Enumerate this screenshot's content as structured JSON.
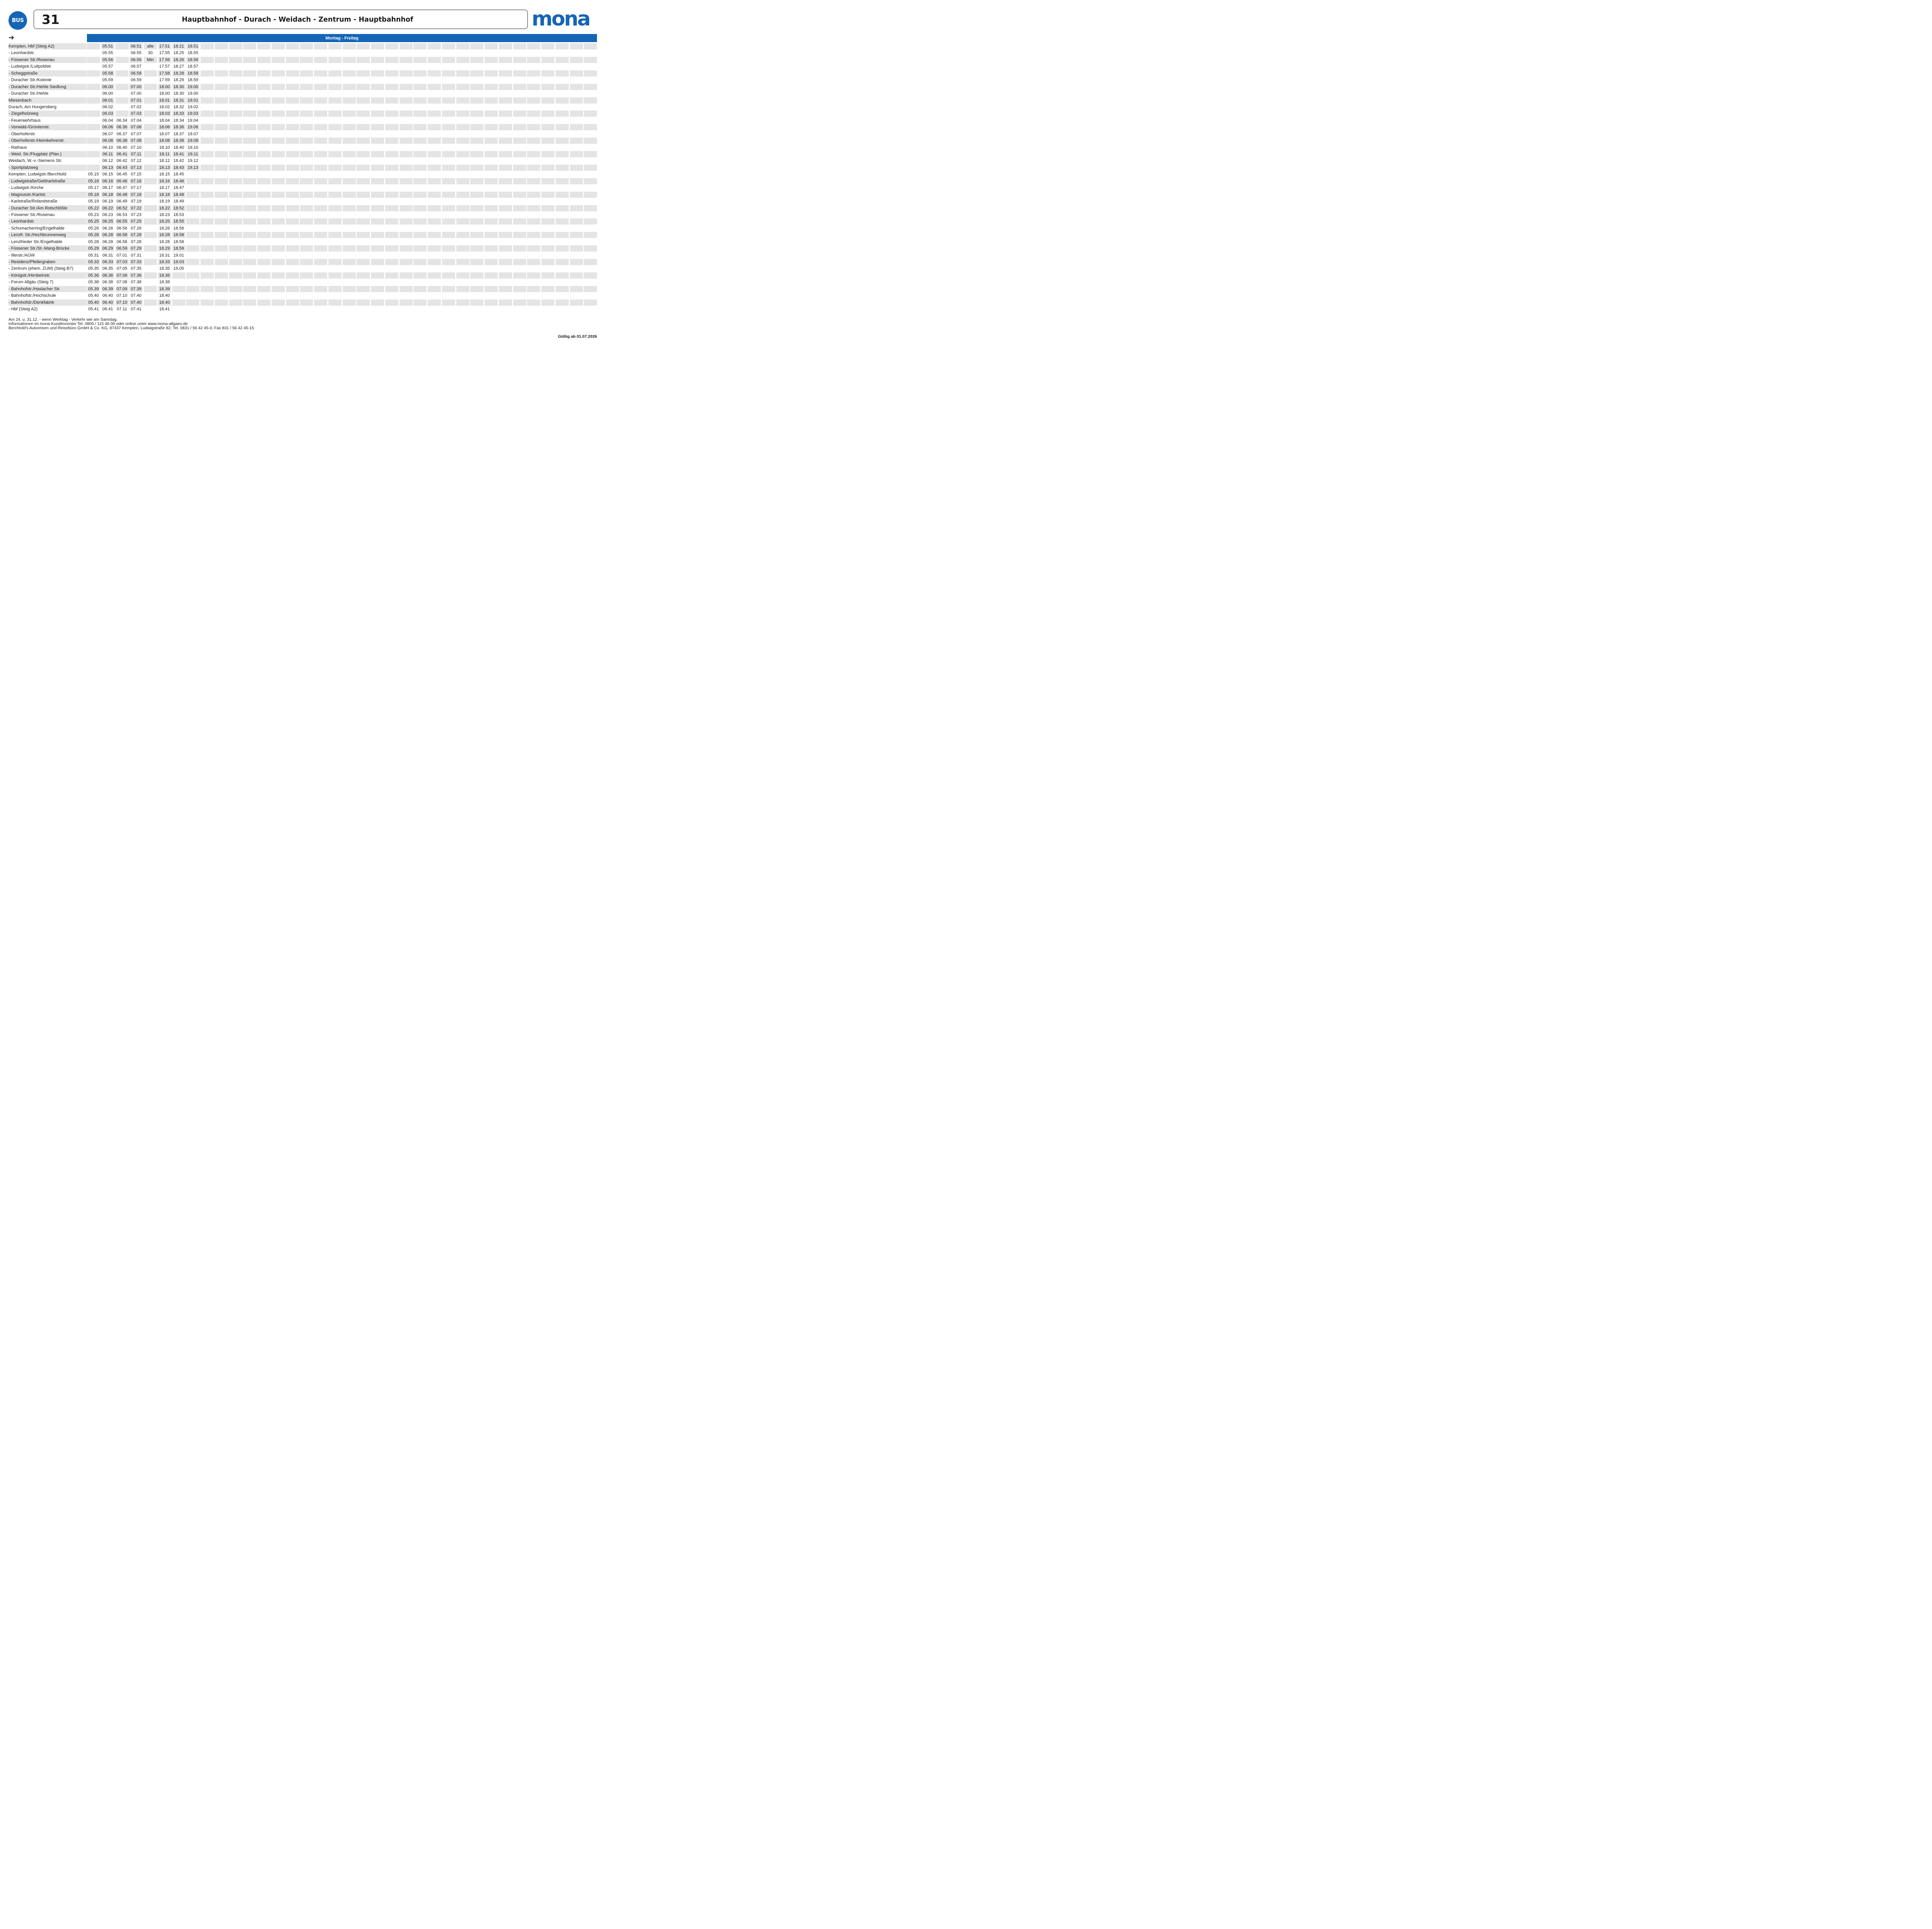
{
  "header": {
    "badge": "BUS",
    "line_number": "31",
    "route": "Hauptbahnhof - Durach - Weidach - Zentrum - Hauptbahnhof",
    "logo_text": "mona",
    "brand_color": "#1565b7"
  },
  "direction_arrow": "➔",
  "day_header": "Montag - Freitag",
  "timetable": {
    "column_count": 36,
    "rows": [
      {
        "stop": "Kempten, Hbf (Steig A2)",
        "times": [
          "",
          "05.51",
          "",
          "06.51",
          "alle",
          "17.51",
          "18.21",
          "18.51"
        ]
      },
      {
        "stop": "- Leonhardstr.",
        "times": [
          "",
          "05.55",
          "",
          "06.55",
          "30",
          "17.55",
          "18.25",
          "18.55"
        ]
      },
      {
        "stop": "- Füssener Str./Rosenau",
        "times": [
          "",
          "05.56",
          "",
          "06.56",
          "Min",
          "17.56",
          "18.26",
          "18.56"
        ]
      },
      {
        "stop": "- Ludwigstr./Luitpoldstr.",
        "times": [
          "",
          "05.57",
          "",
          "06.57",
          "",
          "17.57",
          "18.27",
          "18.57"
        ]
      },
      {
        "stop": "- Scheggstraße",
        "times": [
          "",
          "05.58",
          "",
          "06.58",
          "",
          "17.58",
          "18.28",
          "18.58"
        ]
      },
      {
        "stop": "- Duracher Str./Kolonie",
        "times": [
          "",
          "05.59",
          "",
          "06.59",
          "",
          "17.59",
          "18.29",
          "18.59"
        ]
      },
      {
        "stop": "- Duracher Str./Hehle Siedlung",
        "times": [
          "",
          "06.00",
          "",
          "07.00",
          "",
          "18.00",
          "18.30",
          "19.00"
        ]
      },
      {
        "stop": "- Duracher Str./Hehle",
        "times": [
          "",
          "06.00",
          "",
          "07.00",
          "",
          "18.00",
          "18.30",
          "19.00"
        ]
      },
      {
        "stop": "Miesenbach",
        "times": [
          "",
          "06.01",
          "",
          "07.01",
          "",
          "18.01",
          "18.31",
          "19.01"
        ]
      },
      {
        "stop": "Durach, Am Hungersberg",
        "times": [
          "",
          "06.02",
          "",
          "07.02",
          "",
          "18.02",
          "18.32",
          "19.02"
        ]
      },
      {
        "stop": "- Ziegelholzweg",
        "times": [
          "",
          "06.03",
          "",
          "07.03",
          "",
          "18.03",
          "18.33",
          "19.03"
        ]
      },
      {
        "stop": "- Feuerwehrhaus",
        "times": [
          "",
          "06.04",
          "06.34",
          "07.04",
          "",
          "18.04",
          "18.34",
          "19.04"
        ]
      },
      {
        "stop": "- Vorwald-/Grüntenstr.",
        "times": [
          "",
          "06.06",
          "06.36",
          "07.06",
          "",
          "18.06",
          "18.36",
          "19.06"
        ]
      },
      {
        "stop": "- Oberhoferstr.",
        "times": [
          "",
          "06.07",
          "06.37",
          "07.07",
          "",
          "18.07",
          "18.37",
          "19.07"
        ]
      },
      {
        "stop": "- Oberhoferstr./Heimkehrerstr.",
        "times": [
          "",
          "06.08",
          "06.38",
          "07.08",
          "",
          "18.08",
          "18.38",
          "19.08"
        ]
      },
      {
        "stop": "- Rathaus",
        "times": [
          "",
          "06.10",
          "06.40",
          "07.10",
          "",
          "18.10",
          "18.40",
          "19.10"
        ]
      },
      {
        "stop": "- Weid. Str./Flugplatz (Plan.)",
        "times": [
          "",
          "06.11",
          "06.41",
          "07.11",
          "",
          "18.11",
          "18.41",
          "19.11"
        ]
      },
      {
        "stop": "Weidach, W.-v.-Siemens Str.",
        "times": [
          "",
          "06.12",
          "06.42",
          "07.12",
          "",
          "18.12",
          "18.42",
          "19.12"
        ]
      },
      {
        "stop": "- Sportplatzweg",
        "times": [
          "",
          "06.13",
          "06.43",
          "07.13",
          "",
          "18.13",
          "18.43",
          "19.13"
        ]
      },
      {
        "stop": "Kempten, Ludwigstr./Berchtold",
        "times": [
          "05.15",
          "06.15",
          "06.45",
          "07.15",
          "",
          "18.15",
          "18.45",
          ""
        ]
      },
      {
        "stop": "- Ludwigstraße/Gebhartstraße",
        "times": [
          "05.16",
          "06.16",
          "06.46",
          "07.16",
          "",
          "18.16",
          "18.46",
          ""
        ]
      },
      {
        "stop": "- Ludwigstr./Kirche",
        "times": [
          "05.17",
          "06.17",
          "06.47",
          "07.17",
          "",
          "18.17",
          "18.47",
          ""
        ]
      },
      {
        "stop": "- Magnusstr./Karlstr.",
        "times": [
          "05.18",
          "06.18",
          "06.48",
          "07.18",
          "",
          "18.18",
          "18.48",
          ""
        ]
      },
      {
        "stop": "- Karlstraße/Rolandstraße",
        "times": [
          "05.19",
          "06.19",
          "06.49",
          "07.19",
          "",
          "18.19",
          "18.49",
          ""
        ]
      },
      {
        "stop": "- Duracher Str./Am Rotschlößle",
        "times": [
          "05.22",
          "06.22",
          "06.52",
          "07.22",
          "",
          "18.22",
          "18.52",
          ""
        ]
      },
      {
        "stop": "- Füssener Str./Rosenau",
        "times": [
          "05.23",
          "06.23",
          "06.53",
          "07.23",
          "",
          "18.23",
          "18.53",
          ""
        ]
      },
      {
        "stop": "- Leonhardstr.",
        "times": [
          "05.25",
          "06.25",
          "06.55",
          "07.25",
          "",
          "18.25",
          "18.55",
          ""
        ]
      },
      {
        "stop": "- Schumacherring/Engelhalde",
        "times": [
          "05.26",
          "06.26",
          "06.56",
          "07.26",
          "",
          "18.26",
          "18.56",
          ""
        ]
      },
      {
        "stop": "- Lenzfr. Str./Hochbrunnenweg",
        "times": [
          "05.28",
          "06.28",
          "06.58",
          "07.28",
          "",
          "18.28",
          "18.58",
          ""
        ]
      },
      {
        "stop": "- Lenzfrieder Str./Engelhalde",
        "times": [
          "05.28",
          "06.28",
          "06.58",
          "07.28",
          "",
          "18.28",
          "18.58",
          ""
        ]
      },
      {
        "stop": "- Füssener Str./St.-Mang-Brücke",
        "times": [
          "05.29",
          "06.29",
          "06.59",
          "07.29",
          "",
          "18.29",
          "18.59",
          ""
        ]
      },
      {
        "stop": "- Illerstr./AÜW",
        "times": [
          "05.31",
          "06.31",
          "07.01",
          "07.31",
          "",
          "18.31",
          "19.01",
          ""
        ]
      },
      {
        "stop": "- Residenz/Pfeilergraben",
        "times": [
          "05.33",
          "06.33",
          "07.03",
          "07.33",
          "",
          "18.33",
          "19.03",
          ""
        ]
      },
      {
        "stop": "- Zentrum (ehem. ZUM) (Steig B7)",
        "times": [
          "05.35",
          "06.35",
          "07.05",
          "07.35",
          "",
          "18.35",
          "19.05",
          ""
        ]
      },
      {
        "stop": "- Königstr./Hirnbeinstr.",
        "times": [
          "05.36",
          "06.36",
          "07.06",
          "07.36",
          "",
          "18.36",
          "",
          ""
        ]
      },
      {
        "stop": "- Forum Allgäu (Steig 7)",
        "times": [
          "05.38",
          "06.38",
          "07.08",
          "07.38",
          "",
          "18.38",
          "",
          ""
        ]
      },
      {
        "stop": "- Bahnhofstr./Haslacher Str.",
        "times": [
          "05.39",
          "06.39",
          "07.09",
          "07.39",
          "",
          "18.39",
          "",
          ""
        ]
      },
      {
        "stop": "- Bahnhofstr./Hochschule",
        "times": [
          "05.40",
          "06.40",
          "07.10",
          "07.40",
          "",
          "18.40",
          "",
          ""
        ]
      },
      {
        "stop": "- Bahnhofstr./Denkfabrik",
        "times": [
          "05.40",
          "06.40",
          "07.10",
          "07.40",
          "",
          "18.40",
          "",
          ""
        ]
      },
      {
        "stop": "- Hbf (Steig A2)",
        "times": [
          "05.41",
          "06.41",
          "07.11",
          "07.41",
          "",
          "18.41",
          "",
          ""
        ]
      }
    ]
  },
  "footer": {
    "lines": [
      "Am 24. u. 31.12. - wenn Werktag - Verkehr wie am Samstag.",
      "Informationen im mona Kundencenter Tel. 0800 / 115 46 00 oder online unter www.mona-allgaeu.de",
      "Berchtold's Autoreisen und Reisebüro GmbH & Co. KG, 87437 Kempten, Ludwigstraße 82; Tel. 0831 / 56 42 45-0; Fax 831 / 56 42 45-15"
    ],
    "valid_from": "Gültig ab 01.07.2026"
  }
}
